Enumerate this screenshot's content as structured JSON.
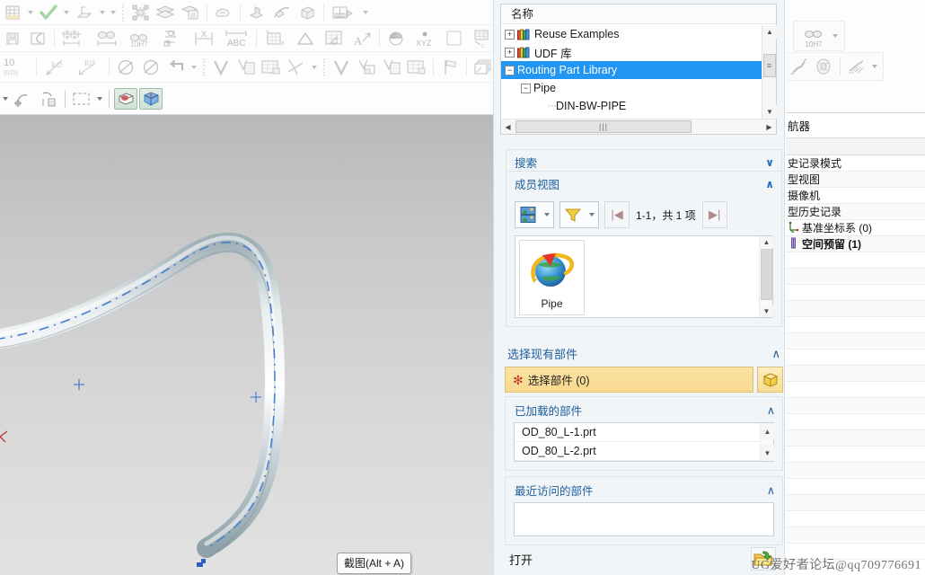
{
  "app": {
    "viewport": {
      "tooltip": "截图(Alt + A)",
      "background_top": "#b9b9b9",
      "background_bottom": "#e2e2e2",
      "pipe_color": "#c6d0d4",
      "centerline_color": "#4a7fd0"
    },
    "watermark": "UG爱好者论坛@qq709776691"
  },
  "toolbars": {
    "row1": [
      {
        "name": "sheet-table-icon",
        "label": ""
      },
      {
        "name": "dropdown-caret",
        "label": ""
      },
      {
        "name": "green-check-icon",
        "label": ""
      },
      {
        "name": "dropdown-caret",
        "label": ""
      },
      {
        "name": "datum-plane-icon",
        "label": ""
      },
      {
        "name": "dropdown-caret",
        "label": ""
      },
      {
        "name": "dropdown-caret",
        "label": ""
      },
      {
        "name": "feature-group-icon",
        "label": ""
      },
      {
        "name": "layers-icon",
        "label": ""
      },
      {
        "name": "layer-settings-icon",
        "label": ""
      },
      {
        "name": "note-icon",
        "label": ""
      },
      {
        "name": "extrude-icon",
        "label": ""
      },
      {
        "name": "sweep-icon",
        "label": ""
      },
      {
        "name": "solid-body-icon",
        "label": ""
      },
      {
        "name": "abc-annotation-icon",
        "label": "ABC"
      },
      {
        "name": "dropdown-caret",
        "label": ""
      }
    ],
    "row2": [
      {
        "name": "save-icon",
        "label": ""
      },
      {
        "name": "arc-icon",
        "label": ""
      },
      {
        "name": "point-grid-icon",
        "label": ""
      },
      {
        "name": "linear-dimension-icon",
        "label": ""
      },
      {
        "name": "tolerance-icon",
        "label": "10H7"
      },
      {
        "name": "chamfer-dim-icon",
        "label": ""
      },
      {
        "name": "x-dimension-icon",
        "label": "X"
      },
      {
        "name": "abc-dimension-icon",
        "label": "ABC"
      },
      {
        "name": "table-x-icon",
        "label": "x"
      },
      {
        "name": "triangle-icon",
        "label": ""
      },
      {
        "name": "table-angle-icon",
        "label": ""
      },
      {
        "name": "leader-text-icon",
        "label": "A"
      },
      {
        "name": "section-pie-icon",
        "label": ""
      },
      {
        "name": "xyz-point-icon",
        "label": "XYZ"
      },
      {
        "name": "blank-rect-icon",
        "label": ""
      },
      {
        "name": "table-note-icon",
        "label": ""
      },
      {
        "name": "text-lines-icon",
        "label": ""
      },
      {
        "name": "measure-icon",
        "label": ""
      }
    ],
    "row3": [
      {
        "name": "tolerance-10-icon",
        "label": "10"
      },
      {
        "name": "radius-dim-icon",
        "label": "R"
      },
      {
        "name": "radius-dim2-icon",
        "label": "R"
      },
      {
        "name": "diameter-icon",
        "label": ""
      },
      {
        "name": "diameter2-icon",
        "label": ""
      },
      {
        "name": "undo-arrow-icon",
        "label": ""
      },
      {
        "name": "dropdown-caret",
        "label": ""
      },
      {
        "name": "check-mark-icon",
        "label": ""
      },
      {
        "name": "list-detail-icon",
        "label": ""
      },
      {
        "name": "table-insert-icon",
        "label": ""
      },
      {
        "name": "axis-icon",
        "label": ""
      },
      {
        "name": "dropdown-caret",
        "label": ""
      },
      {
        "name": "check-mark2-icon",
        "label": ""
      },
      {
        "name": "window-icon",
        "label": ""
      },
      {
        "name": "list-detail2-icon",
        "label": ""
      },
      {
        "name": "table-insert2-icon",
        "label": ""
      },
      {
        "name": "flag-icon",
        "label": ""
      },
      {
        "name": "layers-stack-icon",
        "label": ""
      }
    ],
    "row4": [
      {
        "name": "dropdown-caret",
        "label": ""
      },
      {
        "name": "datum-axis-icon",
        "label": ""
      },
      {
        "name": "wcs-icon",
        "label": ""
      },
      {
        "name": "select-rect-icon",
        "label": ""
      },
      {
        "name": "dropdown-caret",
        "label": ""
      },
      {
        "name": "shaded-view-icon",
        "label": ""
      },
      {
        "name": "studio-view-icon",
        "label": ""
      }
    ]
  },
  "dialog": {
    "tree": {
      "column_header": "名称",
      "nodes": [
        {
          "label": "Reuse Examples",
          "expander": "+",
          "indent": 0,
          "icon": "books-icon",
          "selected": false
        },
        {
          "label": "UDF 库",
          "expander": "+",
          "indent": 0,
          "icon": "books-icon",
          "selected": false
        },
        {
          "label": "Routing Part Library",
          "expander": "−",
          "indent": 0,
          "icon": "",
          "selected": true
        },
        {
          "label": "Pipe",
          "expander": "−",
          "indent": 1,
          "icon": "",
          "selected": false
        },
        {
          "label": "DIN-BW-PIPE",
          "expander": "",
          "indent": 2,
          "icon": "",
          "selected": false
        }
      ]
    },
    "search": {
      "title": "搜索",
      "collapsed": true,
      "chevron": "∨"
    },
    "member_view": {
      "title": "成员视图",
      "collapsed": false,
      "chevron": "∧",
      "view_mode_icon": "thumbnail-view-icon",
      "filter_icon": "filter-funnel-icon",
      "prev_icon": "|◀",
      "next_icon": "▶|",
      "count_text": "1-1，共 1 项",
      "items": [
        {
          "label": "Pipe",
          "icon": "routing-globe-icon"
        }
      ]
    },
    "select_existing": {
      "title": "选择现有部件",
      "chevron": "∧",
      "pick_label": "选择部件 (0)",
      "pick_required_marker": "✻",
      "pick_button_icon": "solid-body-cube-icon",
      "loaded": {
        "title": "已加载的部件",
        "chevron": "∧",
        "items": [
          "OD_80_L-1.prt",
          "OD_80_L-2.prt"
        ]
      },
      "recent": {
        "title": "最近访问的部件",
        "chevron": "∧",
        "items": []
      }
    },
    "open": {
      "label": "打开",
      "button_icon": "open-folder-icon"
    }
  },
  "navigator": {
    "title": "航器",
    "rows": [
      {
        "label": "史记录模式",
        "icon": "",
        "bold": false
      },
      {
        "label": "型视图",
        "icon": "",
        "bold": false
      },
      {
        "label": "摄像机",
        "icon": "",
        "bold": false
      },
      {
        "label": "型历史记录",
        "icon": "",
        "bold": false
      },
      {
        "label": "基准坐标系 (0)",
        "icon": "datum-csys-icon",
        "bold": false
      },
      {
        "label": "空间预留 (1)",
        "icon": "space-reservation-icon",
        "bold": true
      }
    ],
    "empty_row_count": 17,
    "toolbar1": [
      {
        "name": "tolerance-10h7-icon",
        "label": "10H7"
      },
      {
        "name": "dropdown-caret",
        "label": ""
      }
    ],
    "toolbar2": [
      {
        "name": "spring-icon",
        "label": ""
      },
      {
        "name": "coil-icon",
        "label": ""
      },
      {
        "name": "thread-icon",
        "label": ""
      },
      {
        "name": "dropdown-caret",
        "label": ""
      }
    ]
  }
}
